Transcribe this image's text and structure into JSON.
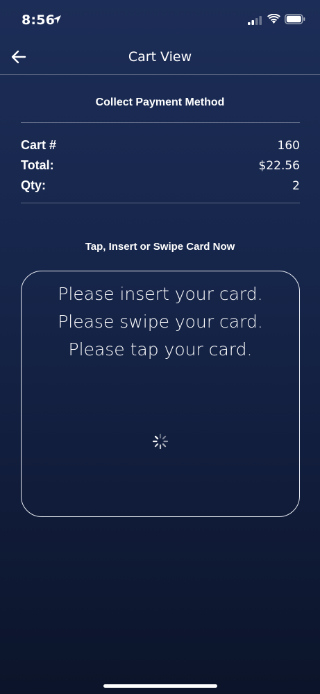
{
  "status_bar": {
    "time": "8:56"
  },
  "nav": {
    "title": "Cart View"
  },
  "section_title": "Collect Payment Method",
  "summary": [
    {
      "label": "Cart #",
      "value": "160"
    },
    {
      "label": "Total:",
      "value": "$22.56"
    },
    {
      "label": "Qty:",
      "value": "2"
    }
  ],
  "instruction": "Tap, Insert or Swipe Card Now",
  "card_prompt": {
    "messages": [
      "Please insert your card.",
      "Please swipe your card.",
      "Please tap your card."
    ]
  },
  "colors": {
    "background_top": "#1c2d57",
    "background_bottom": "#0b1429",
    "text": "#ffffff",
    "card_border": "#e8ebf2"
  }
}
